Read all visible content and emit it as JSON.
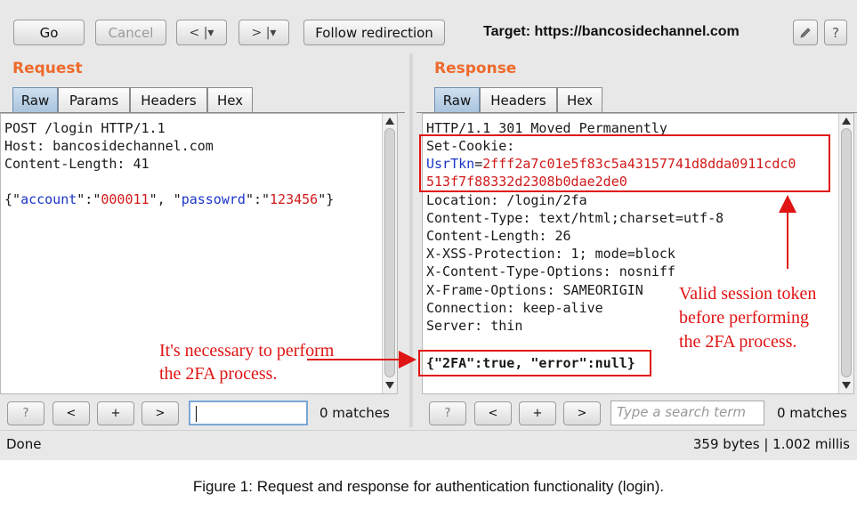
{
  "toolbar": {
    "go": "Go",
    "cancel": "Cancel",
    "back": "< |▾",
    "forward": "> |▾",
    "follow_redirection": "Follow redirection",
    "target_label": "Target: https://bancosidechannel.com",
    "edit_icon": "pencil-icon",
    "help": "?"
  },
  "request": {
    "title": "Request",
    "tabs": [
      "Raw",
      "Params",
      "Headers",
      "Hex"
    ],
    "active_tab": "Raw",
    "lines": {
      "l1": "POST /login HTTP/1.1",
      "l2": "Host: bancosidechannel.com",
      "l3": "Content-Length: 41"
    },
    "body": {
      "brace_open": "{",
      "q1": "\"",
      "k1": "account",
      "q2": "\":\"",
      "v1": "000011",
      "sep": "\", \"",
      "k2": "passowrd",
      "q3": "\":\"",
      "v2": "123456",
      "end": "\"}"
    },
    "search": {
      "help": "?",
      "prev": "<",
      "add": "+",
      "next": ">",
      "value": "",
      "matches": "0 matches"
    }
  },
  "response": {
    "title": "Response",
    "tabs": [
      "Raw",
      "Headers",
      "Hex"
    ],
    "active_tab": "Raw",
    "lines": {
      "l1": "HTTP/1.1 301 Moved Permanently",
      "l2": "Set-Cookie:",
      "cookie_key": "UsrTkn",
      "cookie_eq": "=",
      "cookie_val1": "2fff2a7c01e5f83c5a43157741d8dda0911cdc0",
      "cookie_val2": "513f7f88332d2308b0dae2de0",
      "l5": "Location: /login/2fa",
      "l6": "Content-Type: text/html;charset=utf-8",
      "l7": "Content-Length: 26",
      "l8": "X-XSS-Protection: 1; mode=block",
      "l9": "X-Content-Type-Options: nosniff",
      "l10": "X-Frame-Options: SAMEORIGIN",
      "l11": "Connection: keep-alive",
      "l12": "Server: thin",
      "body": "{\"2FA\":true, \"error\":null}"
    },
    "search": {
      "help": "?",
      "prev": "<",
      "add": "+",
      "next": ">",
      "placeholder": "Type a search term",
      "matches": "0 matches"
    }
  },
  "status": {
    "left": "Done",
    "right": "359 bytes | 1.002 millis"
  },
  "annotations": {
    "token_note_1": "Valid session token",
    "token_note_2": "before performing",
    "token_note_3": "the 2FA process.",
    "twofa_note_1": "It's necessary to perform",
    "twofa_note_2": "the 2FA process."
  },
  "caption": "Figure 1: Request and response for authentication functionality (login).",
  "colors": {
    "section_title": "#ee6a2c",
    "json_key": "#1b35c7",
    "json_value": "#d11a1a",
    "annotation": "#e01414"
  }
}
